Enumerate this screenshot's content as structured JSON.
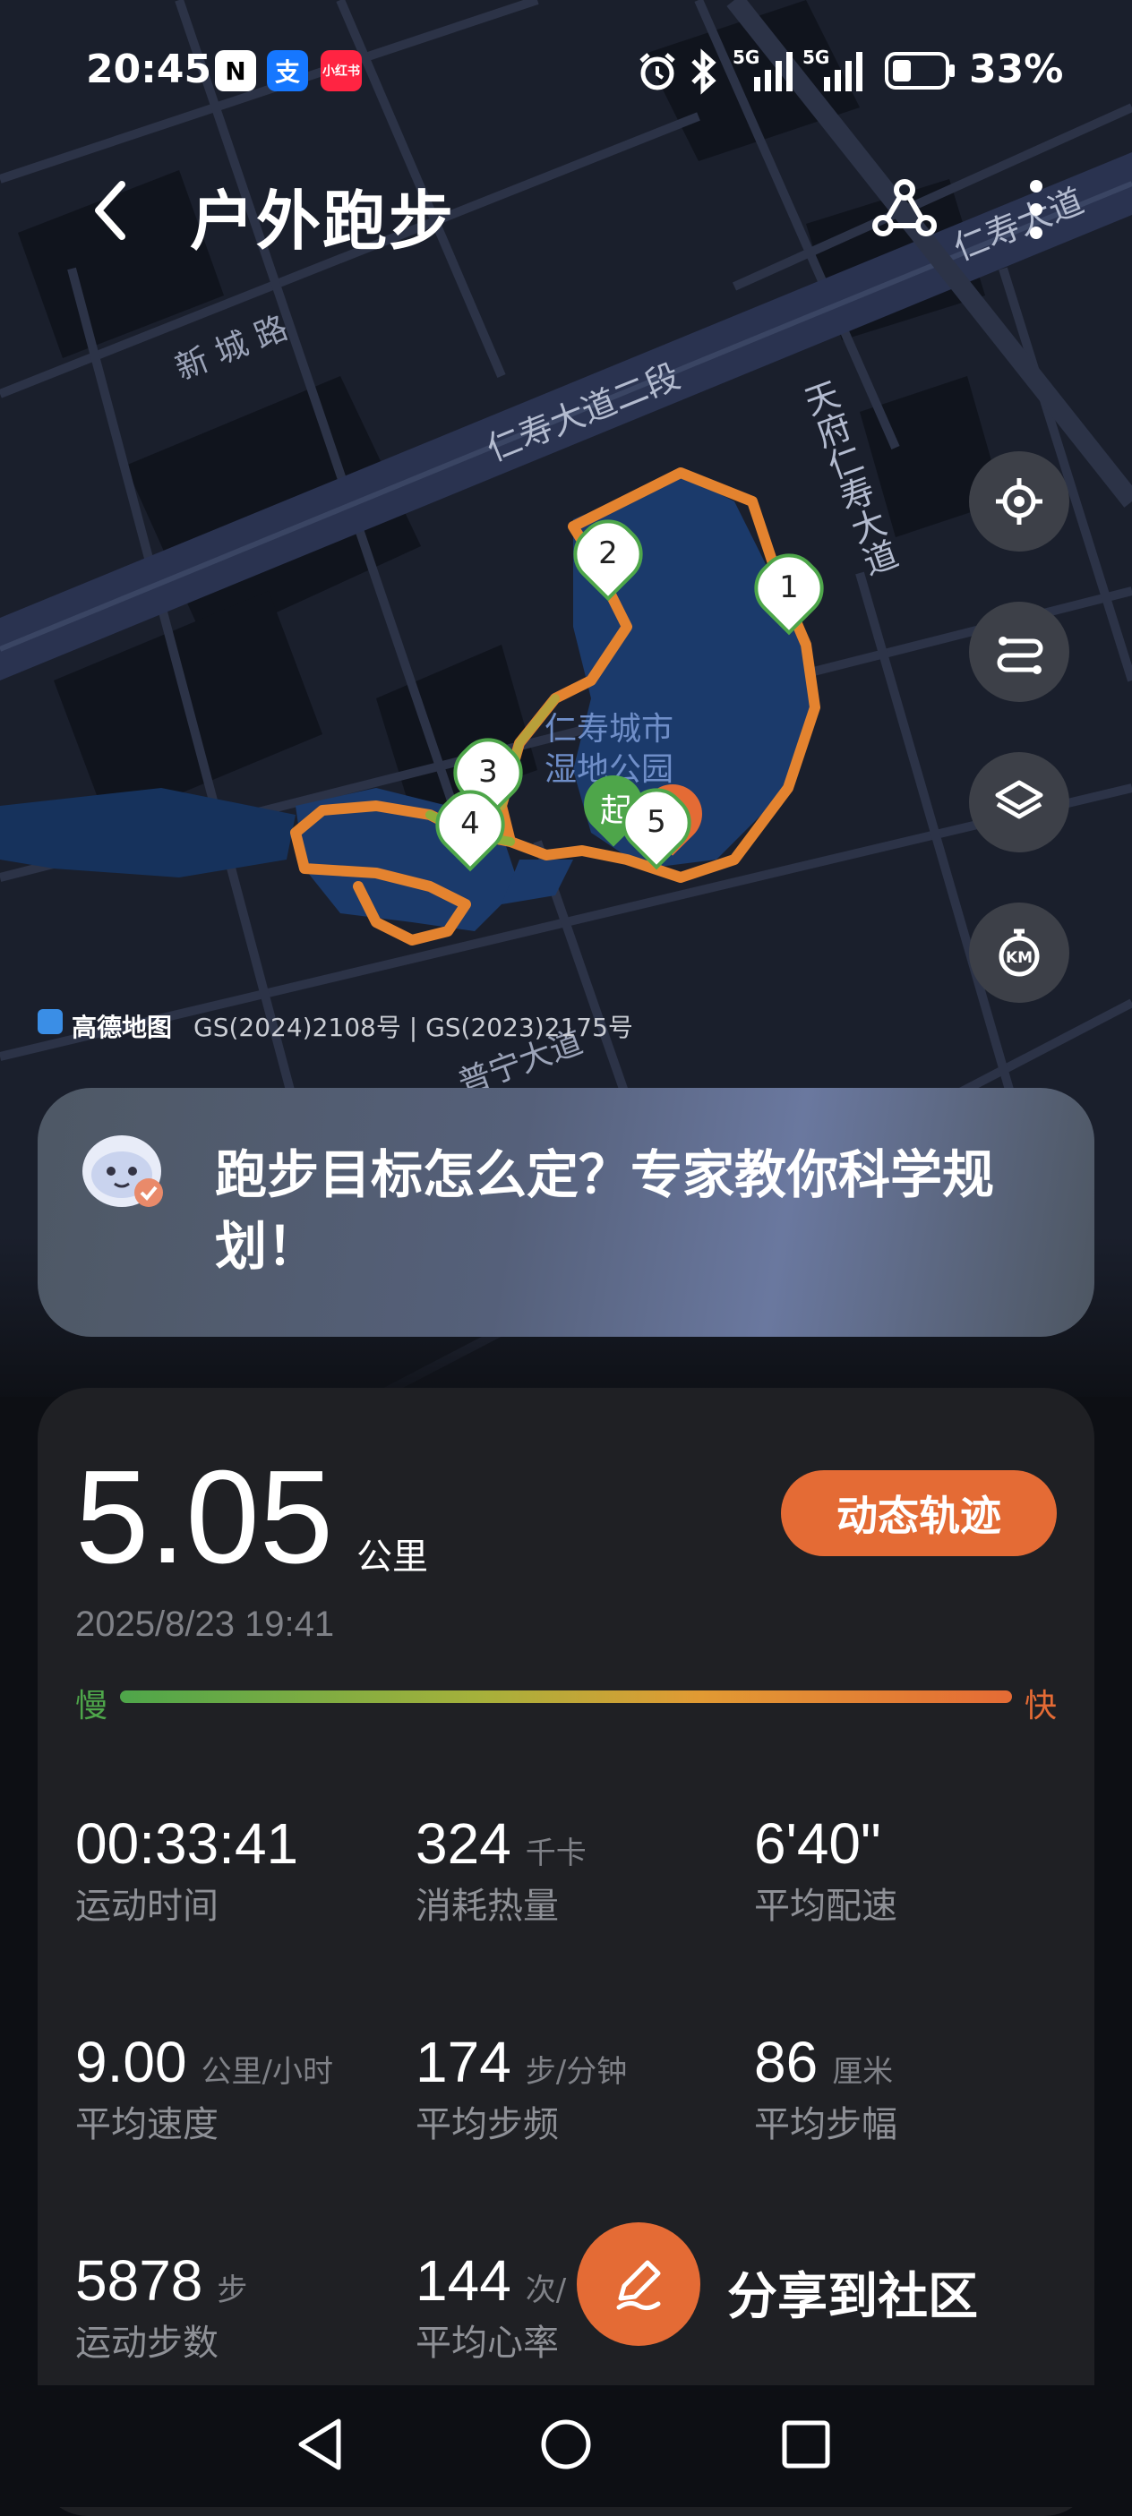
{
  "status_bar": {
    "time": "20:45",
    "badge_alipay": "支",
    "badge_xhs": "小红书",
    "battery": "33%",
    "net1": "5G",
    "net2": "5G"
  },
  "header": {
    "title": "户外跑步"
  },
  "map": {
    "road_labels": [
      "新 城 路",
      "仁寿大道二段",
      "天府仁寿大道",
      "仁寿大道",
      "普宁大道"
    ],
    "park_label_1": "仁寿城市",
    "park_label_2": "湿地公园",
    "marker_start": "起",
    "markers": [
      "1",
      "2",
      "3",
      "4",
      "5"
    ],
    "attribution_brand": "高德地图",
    "attribution_text": "GS(2024)2108号 | GS(2023)2175号"
  },
  "tip": {
    "text": "跑步目标怎么定？专家教你科学规划！"
  },
  "summary": {
    "distance": "5.05",
    "distance_unit": "公里",
    "date": "2025/8/23 19:41",
    "dynamic_button": "动态轨迹",
    "slow_label": "慢",
    "fast_label": "快"
  },
  "stats": [
    {
      "value": "00:33:41",
      "unit": "",
      "label": "运动时间"
    },
    {
      "value": "324",
      "unit": "千卡",
      "label": "消耗热量"
    },
    {
      "value": "6'40\"",
      "unit": "",
      "label": "平均配速"
    },
    {
      "value": "9.00",
      "unit": "公里/小时",
      "label": "平均速度"
    },
    {
      "value": "174",
      "unit": "步/分钟",
      "label": "平均步频"
    },
    {
      "value": "86",
      "unit": "厘米",
      "label": "平均步幅"
    },
    {
      "value": "5878",
      "unit": "步",
      "label": "运动步数"
    },
    {
      "value": "144",
      "unit": "次/",
      "label": "平均心率"
    }
  ],
  "share": {
    "label": "分享到社区"
  },
  "colors": {
    "accent": "#e46b35",
    "green": "#4ea64a",
    "card": "#1f2024",
    "route": "#e4832f"
  }
}
